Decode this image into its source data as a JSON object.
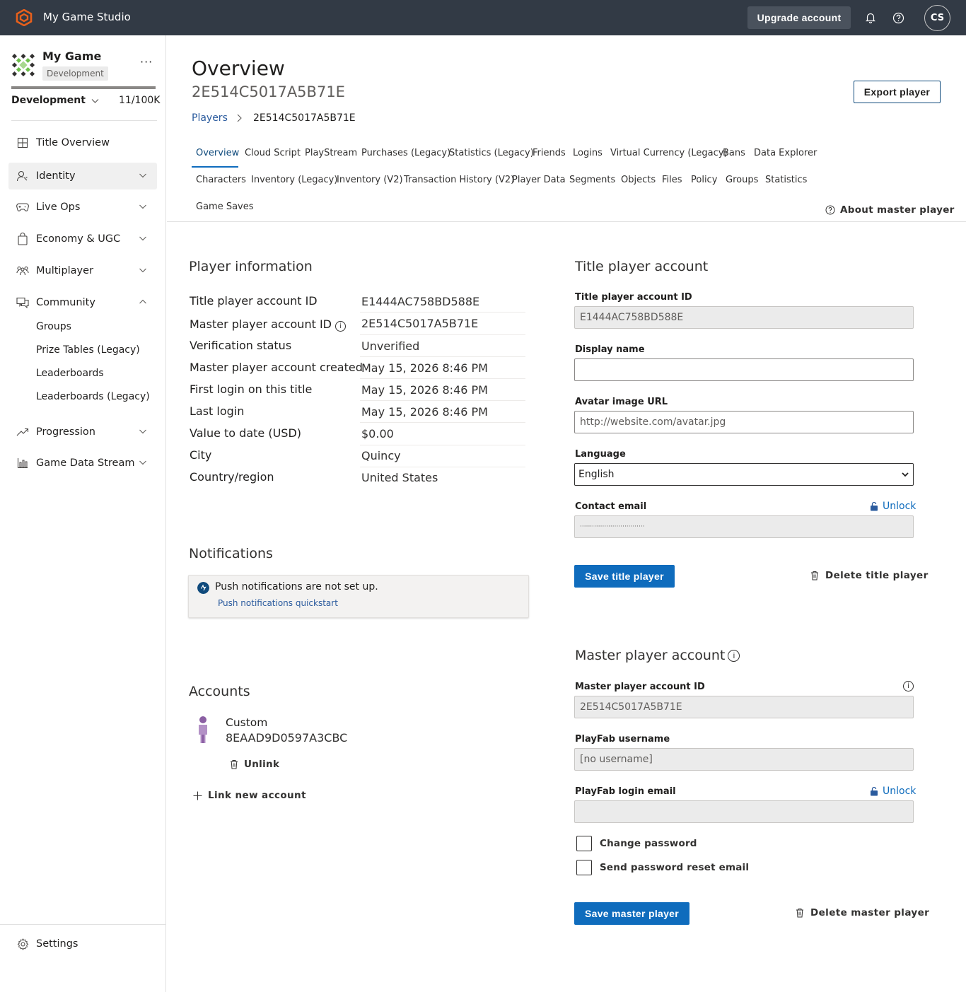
{
  "topbar": {
    "studio_name": "My Game Studio",
    "upgrade_label": "Upgrade account",
    "avatar_initials": "CS",
    "brand_color": "#e8601c"
  },
  "sidebar": {
    "game_name": "My Game",
    "env_badge": "Development",
    "env_select": "Development",
    "usage": "11/100K",
    "usage_fraction": 0.00011,
    "nav": [
      {
        "label": "Title Overview",
        "icon": "grid-icon"
      },
      {
        "label": "Identity",
        "icon": "identity-icon"
      },
      {
        "label": "Live Ops",
        "icon": "gamepad-icon"
      },
      {
        "label": "Economy & UGC",
        "icon": "bag-icon"
      },
      {
        "label": "Multiplayer",
        "icon": "people-icon"
      },
      {
        "label": "Community",
        "icon": "community-icon"
      },
      {
        "label": "Progression",
        "icon": "trending-icon"
      },
      {
        "label": "Game Data Stream",
        "icon": "bar-chart-icon"
      }
    ],
    "community_sub": [
      "Groups",
      "Prize Tables (Legacy)",
      "Leaderboards",
      "Leaderboards (Legacy)"
    ],
    "settings_label": "Settings"
  },
  "header": {
    "title": "Overview",
    "subtitle": "2E514C5017A5B71E",
    "export_label": "Export player",
    "breadcrumb_link": "Players",
    "breadcrumb_current": "2E514C5017A5B71E"
  },
  "tabs": {
    "row1": [
      "Overview",
      "Cloud Script",
      "PlayStream",
      "Purchases (Legacy)",
      "Statistics (Legacy)",
      "Friends",
      "Logins",
      "Virtual Currency (Legacy)",
      "Bans",
      "Data Explorer"
    ],
    "row2": [
      "Characters",
      "Inventory (Legacy)",
      "Inventory (V2)",
      "Transaction History (V2)",
      "Player Data",
      "Segments",
      "Objects",
      "Files",
      "Policy",
      "Groups",
      "Statistics"
    ],
    "row3": [
      "Game Saves"
    ],
    "about_master": "About master player"
  },
  "player_info": {
    "heading": "Player information",
    "rows": [
      {
        "label": "Title player account ID",
        "value": "E1444AC758BD588E"
      },
      {
        "label": "Master player account ID",
        "value": "2E514C5017A5B71E"
      },
      {
        "label": "Verification status",
        "value": "Unverified"
      },
      {
        "label": "Master player account created",
        "value": "May 15, 2026 8:46 PM"
      },
      {
        "label": "First login on this title",
        "value": "May 15, 2026 8:46 PM"
      },
      {
        "label": "Last login",
        "value": "May 15, 2026 8:46 PM"
      },
      {
        "label": "Value to date (USD)",
        "value": "$0.00"
      },
      {
        "label": "City",
        "value": "Quincy"
      },
      {
        "label": "Country/region",
        "value": "United States"
      }
    ]
  },
  "notifications": {
    "heading": "Notifications",
    "message": "Push notifications are not set up.",
    "link": "Push notifications quickstart"
  },
  "accounts": {
    "heading": "Accounts",
    "type": "Custom",
    "id": "8EAAD9D0597A3CBC",
    "unlink_label": "Unlink",
    "link_new_label": "Link new account"
  },
  "title_player": {
    "heading": "Title player account",
    "id_label": "Title player account ID",
    "id_value": "E1444AC758BD588E",
    "display_name_label": "Display name",
    "display_name_value": "",
    "avatar_label": "Avatar image URL",
    "avatar_placeholder": "http://website.com/avatar.jpg",
    "language_label": "Language",
    "language_value": "English",
    "contact_email_label": "Contact email",
    "contact_email_value": "································",
    "unlock_label": "Unlock",
    "save_label": "Save title player",
    "delete_label": "Delete title player"
  },
  "master_player": {
    "heading": "Master player account",
    "id_label": "Master player account ID",
    "id_value": "2E514C5017A5B71E",
    "username_label": "PlayFab username",
    "username_value": "[no username]",
    "login_email_label": "PlayFab login email",
    "login_email_value": "",
    "unlock_label": "Unlock",
    "change_password_label": "Change password",
    "reset_email_label": "Send password reset email",
    "save_label": "Save master player",
    "delete_label": "Delete master player"
  }
}
